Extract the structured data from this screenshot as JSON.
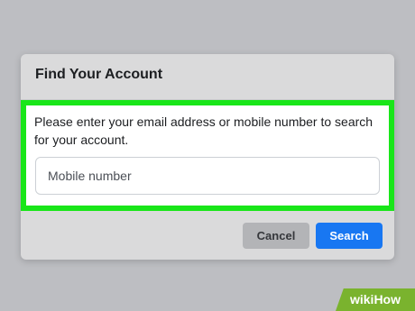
{
  "dialog": {
    "title": "Find Your Account",
    "instructions": "Please enter your email address or mobile number to search for your account.",
    "input_placeholder": "Mobile number",
    "cancel_label": "Cancel",
    "search_label": "Search"
  },
  "colors": {
    "backdrop": "#bdbec2",
    "dialog_background": "#dadadb",
    "highlight": "#19e619",
    "search_button": "#1877f2",
    "cancel_button": "#b3b4b7",
    "watermark": "#7ab32e"
  },
  "watermark": {
    "text": "wikiHow"
  }
}
